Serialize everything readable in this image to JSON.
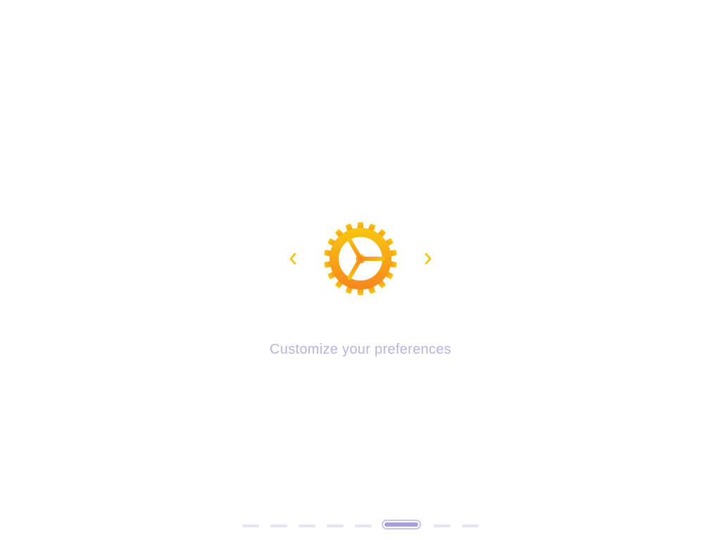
{
  "slide": {
    "icon": "gear-icon",
    "caption": "Customize your preferences",
    "prev_icon": "chevron-left-icon",
    "next_icon": "chevron-right-icon"
  },
  "pager": {
    "total": 8,
    "active_index": 5
  },
  "colors": {
    "caption": "#b9b3dd",
    "arrow": "#f5c400",
    "gear_top": "#f7c70e",
    "gear_bottom": "#f7861f",
    "dot_inactive": "#e6e3f6",
    "dot_active_fill": "#a79fdb",
    "dot_active_ring": "#c9c4ea"
  }
}
